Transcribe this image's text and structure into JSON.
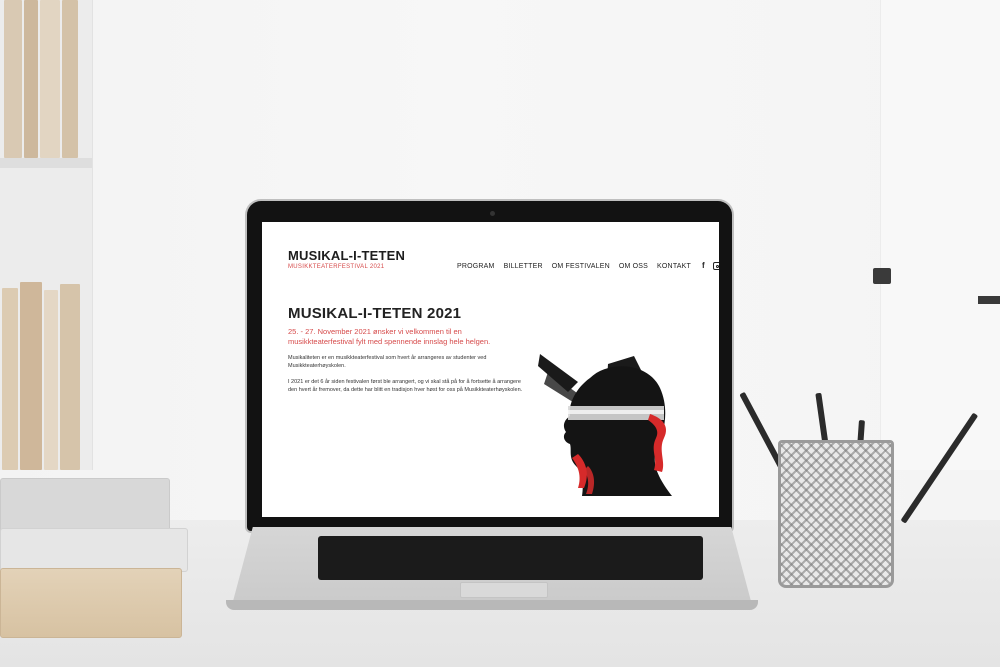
{
  "site": {
    "logo_title": "MUSIKAL-I-TETEN",
    "logo_subtitle": "MUSIKKTEATERFESTIVAL 2021",
    "nav": [
      "PROGRAM",
      "BILLETTER",
      "OM FESTIVALEN",
      "OM OSS",
      "KONTAKT"
    ],
    "social_icons": [
      "facebook-icon",
      "instagram-icon",
      "mail-icon"
    ],
    "social_glyphs": {
      "facebook": "f"
    },
    "page_title": "MUSIKAL-I-TETEN 2021",
    "lead": "25. - 27. November 2021 ønsker vi velkommen til en musikkteaterfestival fylt med spennende innslag hele helgen.",
    "paragraphs": [
      "Musikaliteten er en musikkteaterfestival som hvert år arrangeres av studenter ved Musikkteaterhøyskolen.",
      "I 2021 er det 6 år siden festivalen først ble arrangert, og vi skal stå på for å fortsette å arrangere den hvert år fremover, da dette har blitt en tradisjon hver høst for oss på Musikkteaterhøyskolen."
    ],
    "colors": {
      "accent": "#d64a4a",
      "text": "#222222",
      "poster_red": "#d62a2a"
    }
  }
}
